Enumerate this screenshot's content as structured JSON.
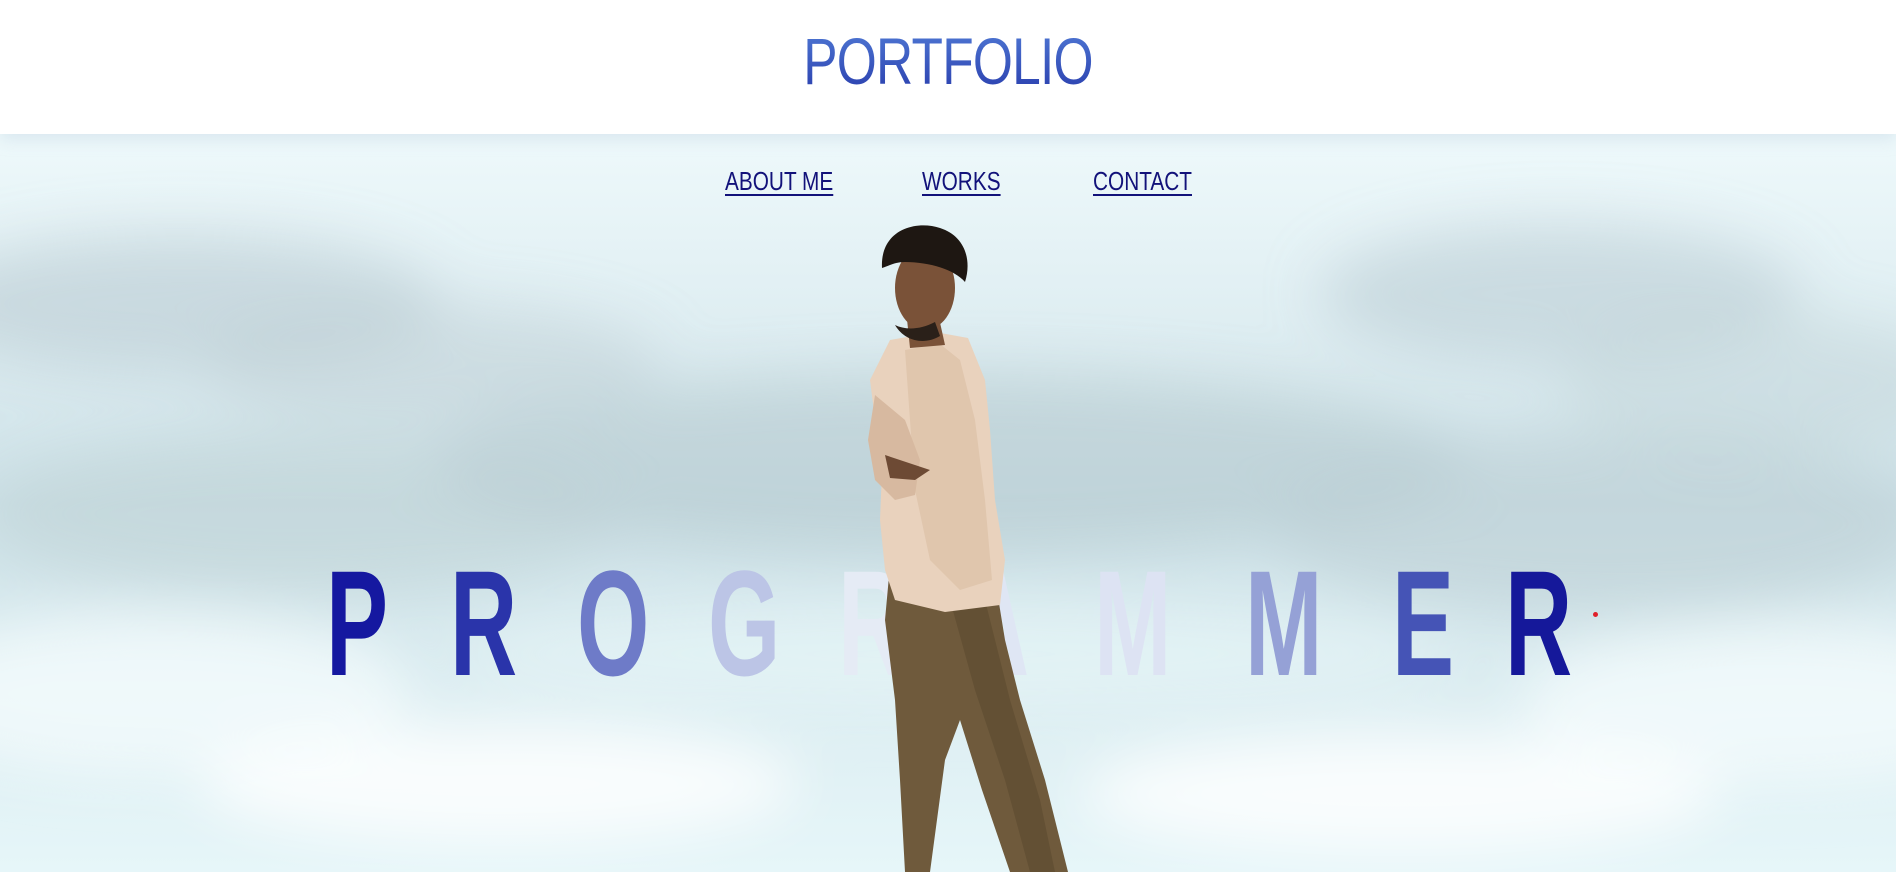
{
  "header": {
    "brand": "PORTFOLIO"
  },
  "nav": {
    "items": [
      {
        "label": "ABOUT ME"
      },
      {
        "label": "WORKS"
      },
      {
        "label": "CONTACT"
      }
    ]
  },
  "hero": {
    "word": "PROGRAMMER",
    "letters": [
      "P",
      "R",
      "O",
      "G",
      "R",
      "A",
      "M",
      "M",
      "E",
      "R"
    ]
  },
  "colors": {
    "brand_top": "#4f78d4",
    "brand_bottom": "#2a3fae",
    "nav_link": "#12127a",
    "letter_dark": "#1a1ea8",
    "letter_light": "#e6ecf6",
    "cursor_dot": "#e0202a"
  }
}
